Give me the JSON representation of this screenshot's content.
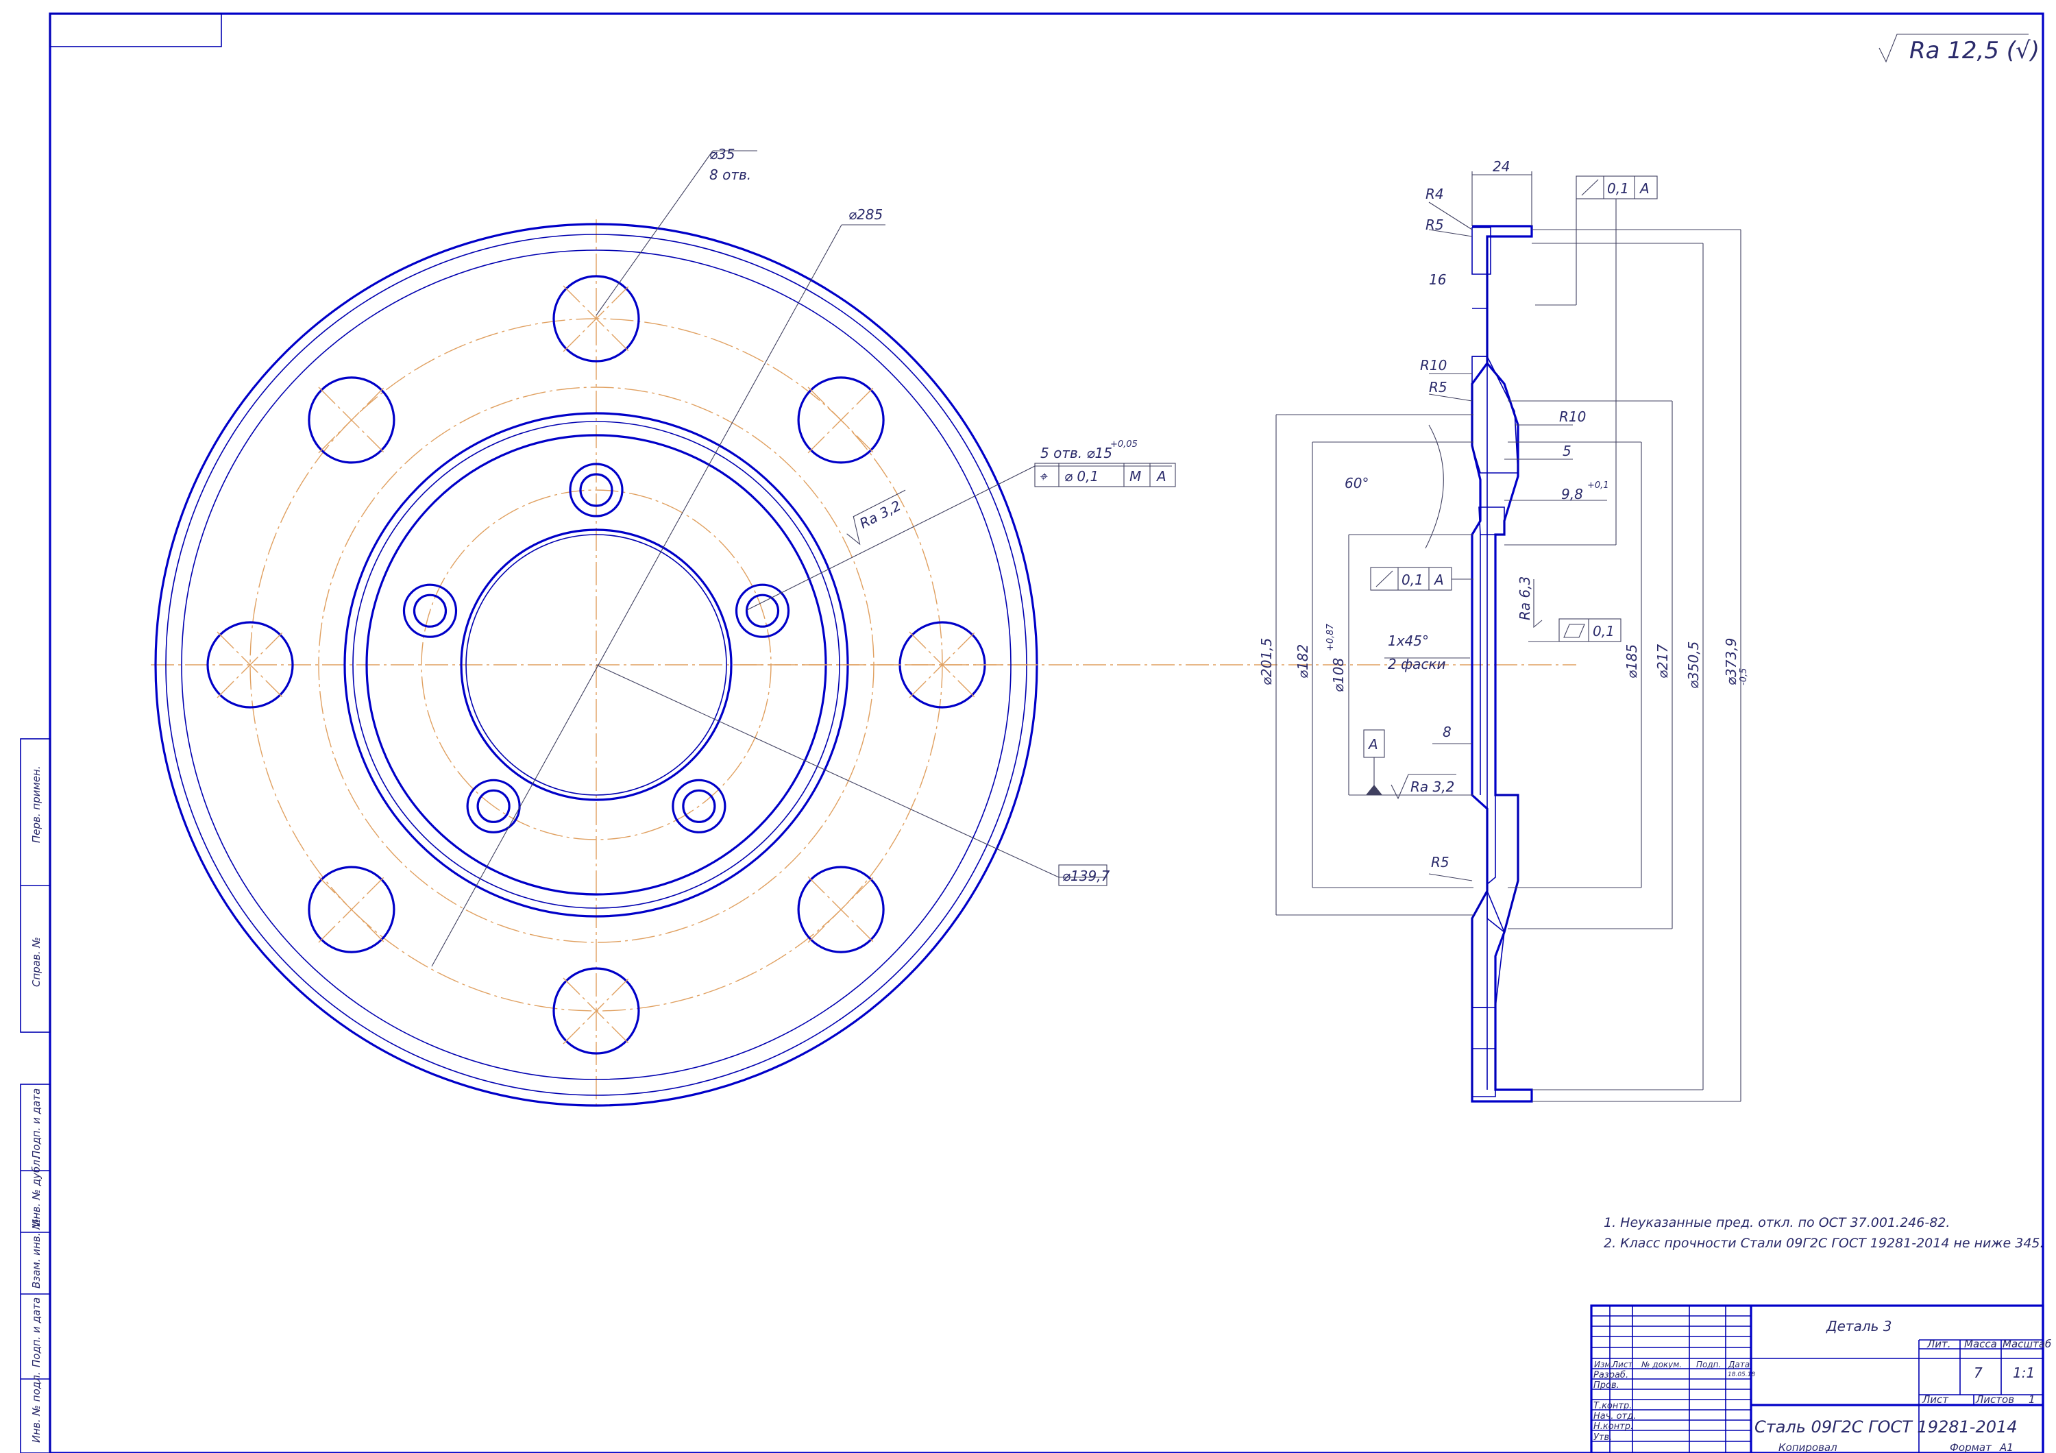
{
  "roughness_general": "Ra 12,5 (√)",
  "front_view": {
    "holes_label_1": "⌀35",
    "holes_label_2": "8 отв.",
    "pcd_label": "⌀285",
    "bolt_holes_label": "5 отв. ⌀15",
    "bolt_holes_tol": "+0,05",
    "position_frame": {
      "symbol": "⌖",
      "value": "⌀ 0,1",
      "modifier": "M",
      "ref1": "M",
      "ref2": "A"
    },
    "roughness_label": "Ra 3,2",
    "center_dia_label": "⌀139,7"
  },
  "section_view": {
    "labels": {
      "r4": "R4",
      "r5_top": "R5",
      "d16": "16",
      "d24": "24",
      "r10_left": "R10",
      "r5_mid": "R5",
      "r10_right": "R10",
      "d5": "5",
      "d98": "9,8",
      "d98_tol": "+0,1",
      "angle": "60°",
      "chamfer": "1х45°",
      "chamfer2": "2 фаски",
      "d8": "8",
      "r5_bottom": "R5",
      "ra63": "Ra 6,3",
      "ra32": "Ra 3,2",
      "datum": "A"
    },
    "frames": {
      "runout_top": {
        "value": "0,1",
        "datum": "A"
      },
      "runout_left": {
        "value": "0,1",
        "datum": "A"
      },
      "flatness": {
        "value": "0,1"
      }
    },
    "diameters": {
      "d2015": "⌀201,5",
      "d182": "⌀182",
      "d1088": "⌀108",
      "d1088_tol": "+0,87",
      "d185": "⌀185",
      "d217": "⌀217",
      "d3505": "⌀350,5",
      "d3739": "⌀373,9",
      "d3739_tol": "-0,5"
    }
  },
  "notes": [
    "1. Неуказанные пред. откл. по ОСТ 37.001.246-82.",
    "2. Класс прочности Стали 09Г2С ГОСТ 19281-2014 не ниже 345."
  ],
  "title_block": {
    "part_name": "Деталь 3",
    "material": "Сталь 09Г2С ГОСТ 19281-2014",
    "lit": "Лит.",
    "mass": "Масса",
    "scale": "Масштаб",
    "mass_value": "7",
    "scale_value": "1:1",
    "sheet": "Лист",
    "sheets": "Листов",
    "sheets_value": "1",
    "copied": "Копировал",
    "format": "Формат",
    "format_value": "А1",
    "rows": [
      "Изм.",
      "Лист",
      "№ докум.",
      "Подп.",
      "Дата"
    ],
    "roles": [
      "Разраб.",
      "Пров.",
      "Т.контр.",
      "Нач. отд.",
      "Н.контр.",
      "Утв."
    ],
    "date": "18.05.18"
  },
  "side_stamp": [
    "Перв. примен.",
    "Справ. №",
    "Подп. и дата",
    "Инв. № дубл.",
    "Взам. инв. №",
    "Подп. и дата",
    "Инв. № подл."
  ]
}
